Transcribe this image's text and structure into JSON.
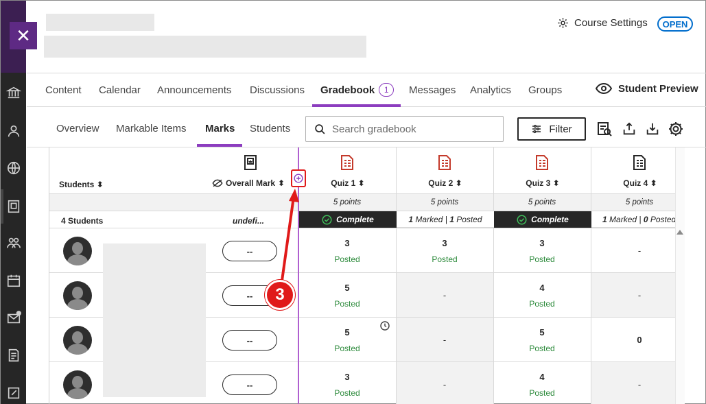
{
  "header": {
    "course_settings_label": "Course Settings",
    "status_badge": "OPEN"
  },
  "main_tabs": [
    {
      "label": "Content"
    },
    {
      "label": "Calendar"
    },
    {
      "label": "Announcements"
    },
    {
      "label": "Discussions"
    },
    {
      "label": "Gradebook",
      "count": "1"
    },
    {
      "label": "Messages"
    },
    {
      "label": "Analytics"
    },
    {
      "label": "Groups"
    }
  ],
  "student_preview_label": "Student Preview",
  "sub_tabs": [
    {
      "label": "Overview"
    },
    {
      "label": "Markable Items"
    },
    {
      "label": "Marks"
    },
    {
      "label": "Students"
    }
  ],
  "search": {
    "placeholder": "Search gradebook"
  },
  "filter_label": "Filter",
  "grid": {
    "students_header": "Students",
    "overall_header": "Overall Mark",
    "students_count": "4 Students",
    "overall_summary": "undefi...",
    "columns": [
      {
        "name": "Quiz 1",
        "points": "5 points",
        "status": "Complete"
      },
      {
        "name": "Quiz 2",
        "points": "5 points",
        "status_marked": "1",
        "status_marked_label": "Marked",
        "status_posted": "1",
        "status_posted_label": "Posted"
      },
      {
        "name": "Quiz 3",
        "points": "5 points",
        "status": "Complete"
      },
      {
        "name": "Quiz 4",
        "points": "5 points",
        "status_marked": "1",
        "status_marked_label": "Marked",
        "status_posted": "0",
        "status_posted_label": "Posted"
      }
    ],
    "rows": [
      {
        "overall": "--",
        "cells": [
          {
            "score": "3",
            "state": "Posted"
          },
          {
            "score": "3",
            "state": "Posted"
          },
          {
            "score": "3",
            "state": "Posted"
          },
          {
            "score": "-",
            "state": ""
          }
        ]
      },
      {
        "overall": "--",
        "cells": [
          {
            "score": "5",
            "state": "Posted"
          },
          {
            "score": "-",
            "state": ""
          },
          {
            "score": "4",
            "state": "Posted"
          },
          {
            "score": "-",
            "state": ""
          }
        ]
      },
      {
        "overall": "--",
        "cells": [
          {
            "score": "5",
            "state": "Posted"
          },
          {
            "score": "-",
            "state": ""
          },
          {
            "score": "5",
            "state": "Posted"
          },
          {
            "score": "0",
            "state": ""
          }
        ]
      },
      {
        "overall": "--",
        "cells": [
          {
            "score": "3",
            "state": "Posted"
          },
          {
            "score": "-",
            "state": ""
          },
          {
            "score": "4",
            "state": "Posted"
          },
          {
            "score": "-",
            "state": ""
          }
        ]
      }
    ]
  },
  "callout": {
    "number": "3"
  },
  "colors": {
    "accent": "#8c3dbf",
    "callout": "#e01a1a",
    "posted": "#2c8a3b",
    "link": "#006dcc"
  }
}
